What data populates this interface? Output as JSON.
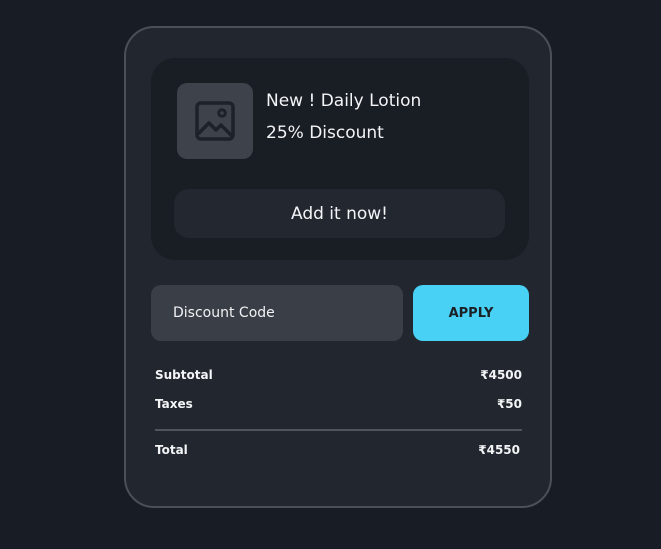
{
  "promo": {
    "title": "New ! Daily Lotion",
    "discount": "25% Discount",
    "add_button_label": "Add it now!",
    "image_icon": "image-icon"
  },
  "discount": {
    "placeholder": "Discount Code",
    "apply_label": "APPLY"
  },
  "summary": {
    "subtotal_label": "Subtotal",
    "subtotal_value": "₹4500",
    "taxes_label": "Taxes",
    "taxes_value": "₹50",
    "total_label": "Total",
    "total_value": "₹4550"
  },
  "colors": {
    "background": "#181c24",
    "card": "#22272f",
    "accent": "#48d1f5"
  }
}
